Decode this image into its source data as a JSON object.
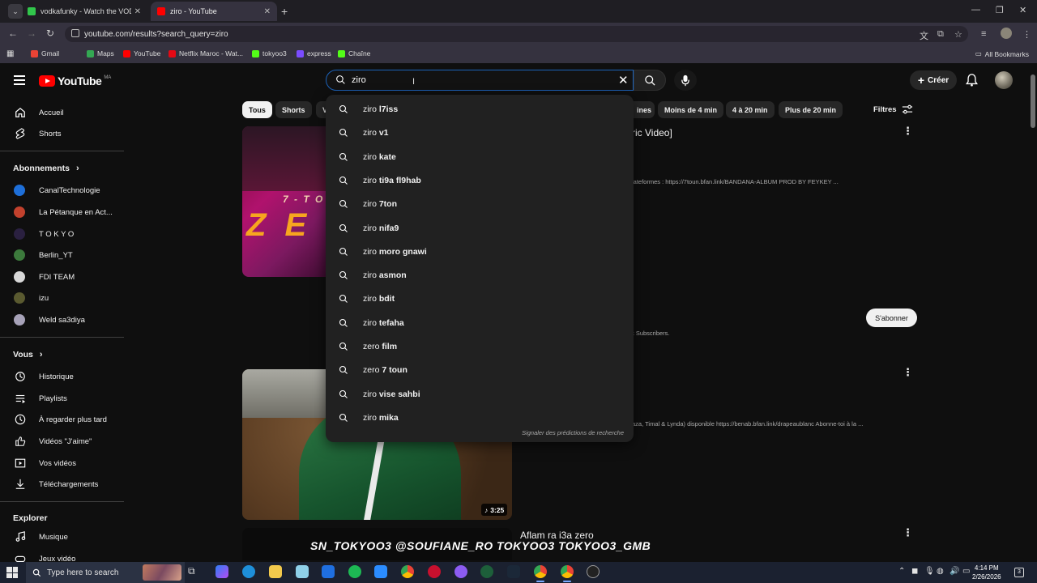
{
  "browser": {
    "tabs": [
      {
        "title": "vodkafunky - Watch the VOD o",
        "color": "#31c64b"
      },
      {
        "title": "ziro - YouTube",
        "color": "#ff0000"
      }
    ],
    "url": "youtube.com/results?search_query=ziro",
    "bookmarks": [
      {
        "label": "Gmail",
        "color": "#ea4335"
      },
      {
        "label": "Maps",
        "color": "#34a853"
      },
      {
        "label": "YouTube",
        "color": "#ff0000"
      },
      {
        "label": "Netflix Maroc - Wat...",
        "color": "#e50914"
      },
      {
        "label": "tokyoo3",
        "color": "#53fc18"
      },
      {
        "label": "express",
        "color": "#7b4cff"
      },
      {
        "label": "Chaîne",
        "color": "#53fc18"
      }
    ],
    "all_bookmarks": "All Bookmarks"
  },
  "header": {
    "logo_text": "YouTube",
    "logo_country": "MA",
    "search_value": "ziro",
    "create_label": "Créer"
  },
  "sidebar": {
    "main": [
      {
        "label": "Accueil",
        "icon": "home-icon"
      },
      {
        "label": "Shorts",
        "icon": "shorts-icon"
      }
    ],
    "subscriptions_title": "Abonnements",
    "subscriptions": [
      {
        "label": "CanalTechnologie",
        "color": "#1e6fd9"
      },
      {
        "label": "La Pétanque en Act...",
        "color": "#c2412d"
      },
      {
        "label": "T O K Y O",
        "color": "#2a2040"
      },
      {
        "label": "Berlin_YT",
        "color": "#3c7a3c"
      },
      {
        "label": "FDI TEAM",
        "color": "#d8d8d8"
      },
      {
        "label": "izu",
        "color": "#5a5a30"
      },
      {
        "label": "Weld sa3diya",
        "color": "#a7a2b8"
      }
    ],
    "you_title": "Vous",
    "you": [
      {
        "label": "Historique",
        "icon": "history-icon"
      },
      {
        "label": "Playlists",
        "icon": "playlists-icon"
      },
      {
        "label": "À regarder plus tard",
        "icon": "watch-later-icon"
      },
      {
        "label": "Vidéos \"J'aime\"",
        "icon": "like-icon"
      },
      {
        "label": "Vos vidéos",
        "icon": "your-videos-icon"
      },
      {
        "label": "Téléchargements",
        "icon": "download-icon"
      }
    ],
    "explore_title": "Explorer",
    "explore": [
      {
        "label": "Musique",
        "icon": "music-icon"
      },
      {
        "label": "Jeux vidéo",
        "icon": "gaming-icon"
      }
    ]
  },
  "chips": [
    "Tous",
    "Shorts",
    "V",
    "ines",
    "Moins de 4 min",
    "4 à 20 min",
    "Plus de 20 min"
  ],
  "filters_label": "Filtres",
  "results": [
    {
      "title": "ric Video]",
      "desc": "lateformes : https://7toun.bfan.link/BANDANA-ALBUM PROD BY FEYKEY ...",
      "thumb_text_small": "7 - T O",
      "thumb_text_big": "Z E"
    },
    {
      "channel_desc": "k Subscribers.",
      "subscribe_label": "S'abonner"
    },
    {
      "desc": "aza, Timal & Lynda) disponible https://benab.bfan.link/drapeaublanc Abonne-toi à la ...",
      "duration": "3:25"
    },
    {
      "title": "Aflam ra i3a zero",
      "thumb_overlay": "SN_TOKYOO3  @SOUFIANE_RO  TOKYOO3  TOKYOO3_GMB"
    }
  ],
  "suggestions": {
    "query": "ziro",
    "items": [
      {
        "q": "ziro",
        "c": "l7iss"
      },
      {
        "q": "ziro",
        "c": "v1"
      },
      {
        "q": "ziro",
        "c": "kate"
      },
      {
        "q": "ziro",
        "c": "ti9a fl9hab"
      },
      {
        "q": "ziro",
        "c": "7ton"
      },
      {
        "q": "ziro",
        "c": "nifa9"
      },
      {
        "q": "ziro",
        "c": "moro gnawi"
      },
      {
        "q": "ziro",
        "c": "asmon"
      },
      {
        "q": "ziro",
        "c": "bdit"
      },
      {
        "q": "ziro",
        "c": "tefaha"
      },
      {
        "q": "zero",
        "c": "film"
      },
      {
        "q": "zero",
        "c": "7 toun"
      },
      {
        "q": "ziro",
        "c": "vise sahbi"
      },
      {
        "q": "ziro",
        "c": "mika"
      }
    ],
    "report_label": "Signaler des prédictions de recherche"
  },
  "taskbar": {
    "search_placeholder": "Type here to search",
    "time": "4:14 PM",
    "date": "2/26/2026",
    "notifications": "3"
  }
}
